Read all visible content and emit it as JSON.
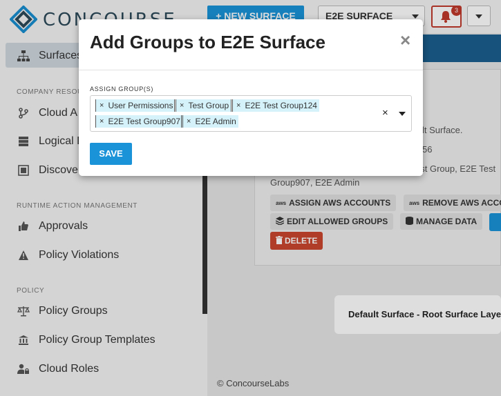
{
  "header": {
    "logo_text": "CONCOURSE",
    "new_surface_label": "+ NEW SURFACE",
    "surface_select_value": "E2E SURFACE",
    "notification_count": "3"
  },
  "sidebar": {
    "top_item": "Surfaces",
    "sections": [
      {
        "title": "COMPANY RESOU",
        "items": [
          "Cloud A",
          "Logical D",
          "Discove"
        ]
      },
      {
        "title": "RUNTIME ACTION MANAGEMENT",
        "items": [
          "Approvals",
          "Policy Violations"
        ]
      },
      {
        "title": "POLICY",
        "items": [
          "Policy Groups",
          "Policy Group Templates",
          "Cloud Roles"
        ]
      }
    ]
  },
  "main": {
    "text_1": "lt Surface.",
    "text_2": "56",
    "text_3": "est Group, E2E Test",
    "text_4": "Group907, E2E Admin",
    "buttons": {
      "assign_aws": "ASSIGN AWS ACCOUNTS",
      "remove_aws": "REMOVE AWS ACCO",
      "edit_groups": "EDIT ALLOWED GROUPS",
      "manage_data": "MANAGE DATA",
      "delete": "DELETE"
    },
    "layer_card": "Default Surface - Root Surface Laye",
    "footer": "© ConcourseLabs"
  },
  "modal": {
    "title": "Add Groups to E2E Surface",
    "close": "×",
    "field_label": "ASSIGN GROUP(S)",
    "tags": [
      "User Permissions",
      "Test Group",
      "E2E Test Group124",
      "E2E Test Group907",
      "E2E Admin"
    ],
    "tag_remove": "×",
    "clear": "×",
    "save_label": "SAVE"
  },
  "colors": {
    "primary": "#1a93d9",
    "danger": "#c9472f",
    "tag_bg": "#d5f2fa",
    "band": "#1a5f8e"
  }
}
